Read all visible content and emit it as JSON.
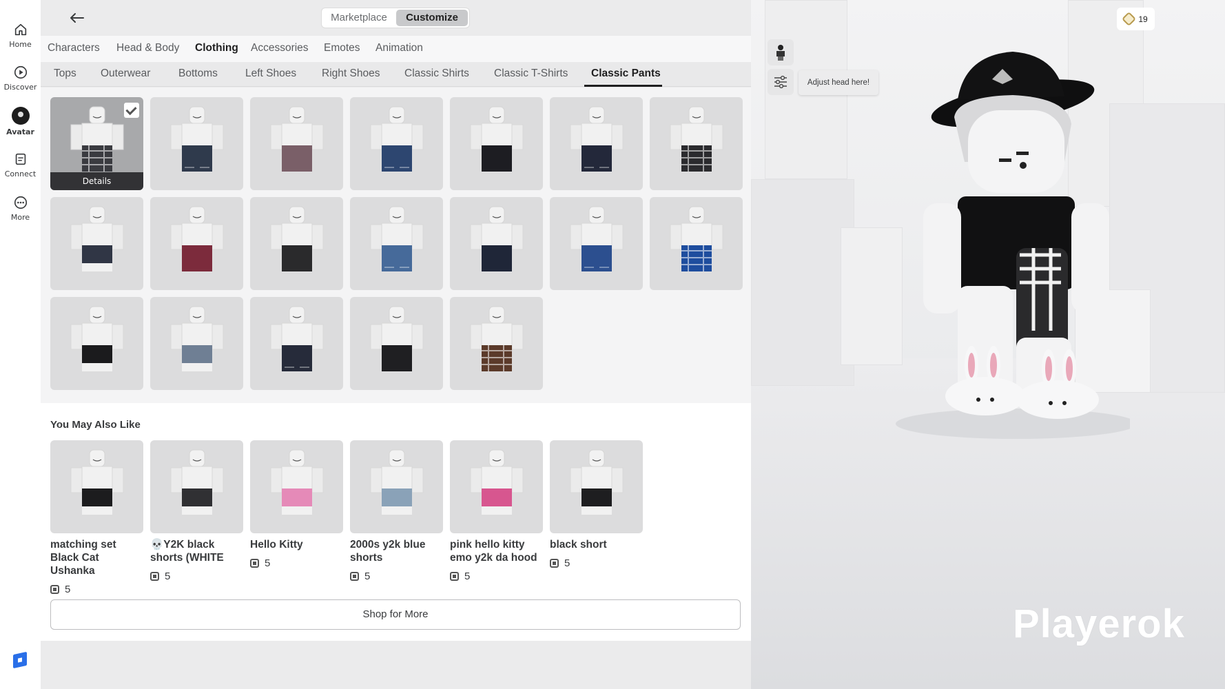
{
  "sidebar": {
    "items": [
      {
        "label": "Home",
        "icon": "home-icon"
      },
      {
        "label": "Discover",
        "icon": "play-icon"
      },
      {
        "label": "Avatar",
        "icon": "avatar-icon"
      },
      {
        "label": "Connect",
        "icon": "chat-icon"
      },
      {
        "label": "More",
        "icon": "more-icon"
      }
    ]
  },
  "header": {
    "marketplace_label": "Marketplace",
    "customize_label": "Customize",
    "active_mode": "Customize"
  },
  "categories": [
    "Characters",
    "Head & Body",
    "Clothing",
    "Accessories",
    "Emotes",
    "Animation"
  ],
  "active_category": "Clothing",
  "subcategories": [
    "Tops",
    "Outerwear",
    "Bottoms",
    "Left Shoes",
    "Right Shoes",
    "Classic Shirts",
    "Classic T-Shirts",
    "Classic Pants"
  ],
  "active_subcategory": "Classic Pants",
  "inventory": {
    "details_label": "Details",
    "items": [
      {
        "pants": "#3a3b40",
        "pattern": "plaid",
        "selected": true
      },
      {
        "pants": "#2f3a4c",
        "pattern": "denim"
      },
      {
        "pants": "#7a5f68",
        "pattern": "plain"
      },
      {
        "pants": "#2d4670",
        "pattern": "denim"
      },
      {
        "pants": "#1d1d22",
        "pattern": "plain"
      },
      {
        "pants": "#23283a",
        "pattern": "denim"
      },
      {
        "pants": "#2b2b2e",
        "pattern": "plaid"
      },
      {
        "pants": "#303645",
        "pattern": "shorts"
      },
      {
        "pants": "#7c2b3c",
        "pattern": "plain"
      },
      {
        "pants": "#2a2a2c",
        "pattern": "plain"
      },
      {
        "pants": "#466a9a",
        "pattern": "denim"
      },
      {
        "pants": "#1f2638",
        "pattern": "plain"
      },
      {
        "pants": "#2c4f8f",
        "pattern": "denim"
      },
      {
        "pants": "#1e4d9e",
        "pattern": "plaid"
      },
      {
        "pants": "#1b1b1d",
        "pattern": "shorts"
      },
      {
        "pants": "#6f7f94",
        "pattern": "shorts"
      },
      {
        "pants": "#262b3a",
        "pattern": "denim"
      },
      {
        "pants": "#1f1f22",
        "pattern": "plain"
      },
      {
        "pants": "#5b3a2a",
        "pattern": "plaid"
      }
    ]
  },
  "recommendations": {
    "title": "You May Also Like",
    "items": [
      {
        "name": "matching set Black Cat Ushanka",
        "price": "5",
        "pants": "#1c1c1e"
      },
      {
        "name": "💀Y2K black shorts (WHITE",
        "price": "5",
        "pants": "#303033"
      },
      {
        "name": "Hello Kitty",
        "price": "5",
        "pants": "#e58ab8"
      },
      {
        "name": "2000s y2k blue shorts",
        "price": "5",
        "pants": "#8aa2b8"
      },
      {
        "name": "pink hello kitty emo y2k da hood",
        "price": "5",
        "pants": "#d7568f"
      },
      {
        "name": "black short",
        "price": "5",
        "pants": "#1e1e20"
      }
    ],
    "shop_label": "Shop for More"
  },
  "scene": {
    "robux_balance": "19",
    "tooltip": "Adjust head here!",
    "watermark": "Playerok"
  }
}
